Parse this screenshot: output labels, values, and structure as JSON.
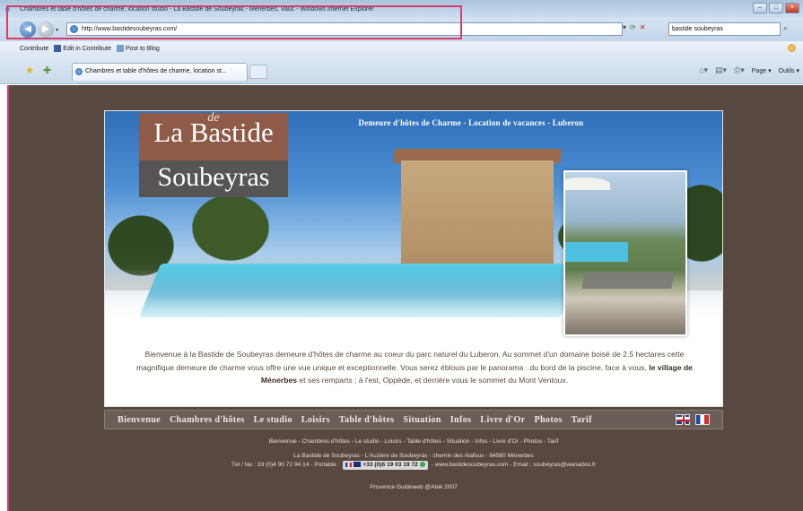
{
  "window": {
    "title": "Chambres et table d'hôtes de charme, location studio - La Bastide de Soubeyras - Ménerbes, Vauc - Windows Internet Explorer"
  },
  "address": {
    "url": "http://www.bastidesoubeyras.com/",
    "search_value": "bastide soubeyras"
  },
  "linksbar": {
    "contribute": "Contribute",
    "edit_in_contribute": "Edit in Contribute",
    "post_to_blog": "Post to Blog"
  },
  "tabs": {
    "active_label": "Chambres et table d'hôtes de charme, location st..."
  },
  "commandbar": {
    "page": "Page",
    "tools": "Outils"
  },
  "hero": {
    "logo_line1": "La Bastide",
    "logo_line2": "de",
    "logo_line3": "Soubeyras",
    "tagline": "Demeure d'hôtes de Charme - Location de vacances - Luberon"
  },
  "intro": {
    "part1": "Bienvenue à la Bastide de Soubeyras demeure d'hôtes de charme au coeur du parc naturel du Luberon. Au sommet d'un domaine boisé de 2.5 hectares cette magnifique demeure de charme vous offre une vue unique et exceptionnelle. Vous serez éblouis par le panorama : du bord de la piscine, face à vous,",
    "highlight": "le village de Ménerbes",
    "part2": "et ses remparts ; à l'est, Oppède, et derrière vous le sommet du Mont Ventoux."
  },
  "menu": {
    "items": [
      "Bienvenue",
      "Chambres d'hôtes",
      "Le studio",
      "Loisirs",
      "Table d'hôtes",
      "Situation",
      "Infos",
      "Livre d'Or",
      "Photos",
      "Tarif"
    ]
  },
  "footer": {
    "links": "Bienvenue - Chambres d'hôtes - Le studio - Loisirs - Table d'hôtes - Situation - Infos - Livre d'Or - Photos - Tarif",
    "address": "La Bastide de Soubeyras - L'Auzière de Soubeyras - chemin des Alafoux - 84560 Ménerbes",
    "phone_prefix": "Tél / fax : 33 (0)4 90 72 94 14 - Portable :",
    "mobile": "+33 (0)6 19 03 19 72",
    "phone_suffix": "- www.bastidesoubeyras.com - Email : soubeyras@wanadoo.fr",
    "credit": "Provence Guideweb @Atek 2007"
  }
}
